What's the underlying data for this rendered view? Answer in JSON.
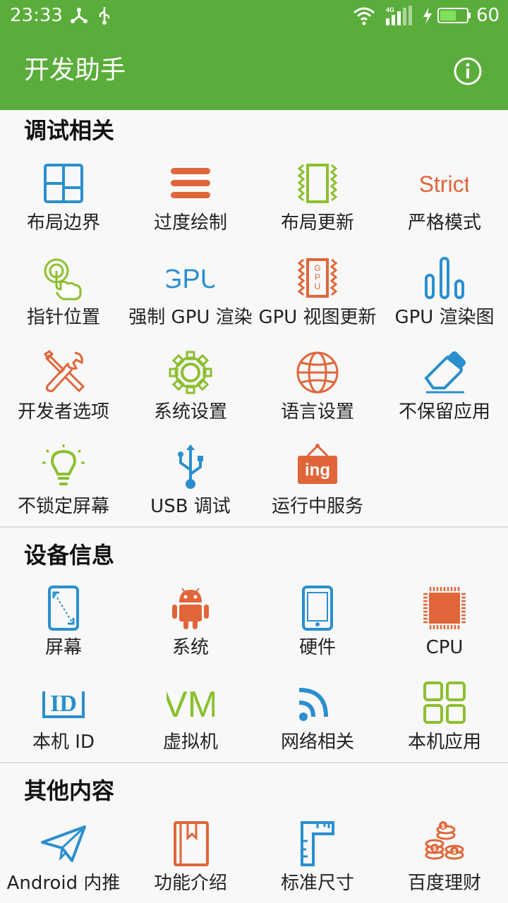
{
  "status_bar": {
    "time": "23:33",
    "network_type": "4G",
    "battery_level": "60",
    "battery_fraction": 0.6,
    "left_icons": [
      "share-icon",
      "usb-icon"
    ],
    "right_icons": [
      "wifi-icon",
      "signal-icon",
      "charging-icon",
      "battery-icon"
    ]
  },
  "app_bar": {
    "title": "开发助手",
    "info_icon": "info-icon"
  },
  "colors": {
    "primary": "#5aad3a",
    "blue": "#2a8fcf",
    "orange": "#e0663a",
    "green": "#8cbf2f"
  },
  "sections": [
    {
      "title": "调试相关",
      "items": [
        {
          "label": "布局边界",
          "icon": "layout-bounds-icon"
        },
        {
          "label": "过度绘制",
          "icon": "overdraw-icon"
        },
        {
          "label": "布局更新",
          "icon": "layout-update-icon"
        },
        {
          "label": "严格模式",
          "icon": "strict-mode-icon",
          "icon_text": "Strict"
        },
        {
          "label": "指针位置",
          "icon": "pointer-location-icon"
        },
        {
          "label": "强制 GPU 渲染",
          "icon": "gpu-text-icon",
          "icon_text": "GPU"
        },
        {
          "label": "GPU 视图更新",
          "icon": "gpu-view-update-icon",
          "icon_text": "GPU"
        },
        {
          "label": "GPU 渲染图",
          "icon": "gpu-render-bars-icon"
        },
        {
          "label": "开发者选项",
          "icon": "developer-tools-icon"
        },
        {
          "label": "系统设置",
          "icon": "gear-icon"
        },
        {
          "label": "语言设置",
          "icon": "globe-icon"
        },
        {
          "label": "不保留应用",
          "icon": "eraser-icon"
        },
        {
          "label": "不锁定屏幕",
          "icon": "lightbulb-icon"
        },
        {
          "label": "USB 调试",
          "icon": "usb-icon"
        },
        {
          "label": "运行中服务",
          "icon": "running-services-icon",
          "icon_text": "ing"
        }
      ]
    },
    {
      "title": "设备信息",
      "items": [
        {
          "label": "屏幕",
          "icon": "screen-icon"
        },
        {
          "label": "系统",
          "icon": "android-icon"
        },
        {
          "label": "硬件",
          "icon": "phone-hardware-icon"
        },
        {
          "label": "CPU",
          "icon": "cpu-chip-icon"
        },
        {
          "label": "本机 ID",
          "icon": "device-id-icon",
          "icon_text": "ID"
        },
        {
          "label": "虚拟机",
          "icon": "vm-icon",
          "icon_text": "VM"
        },
        {
          "label": "网络相关",
          "icon": "network-icon"
        },
        {
          "label": "本机应用",
          "icon": "apps-grid-icon"
        }
      ]
    },
    {
      "title": "其他内容",
      "items": [
        {
          "label": "Android 内推",
          "icon": "paper-plane-icon"
        },
        {
          "label": "功能介绍",
          "icon": "bookmark-book-icon"
        },
        {
          "label": "标准尺寸",
          "icon": "ruler-icon"
        },
        {
          "label": "百度理财",
          "icon": "coins-icon"
        }
      ]
    }
  ]
}
